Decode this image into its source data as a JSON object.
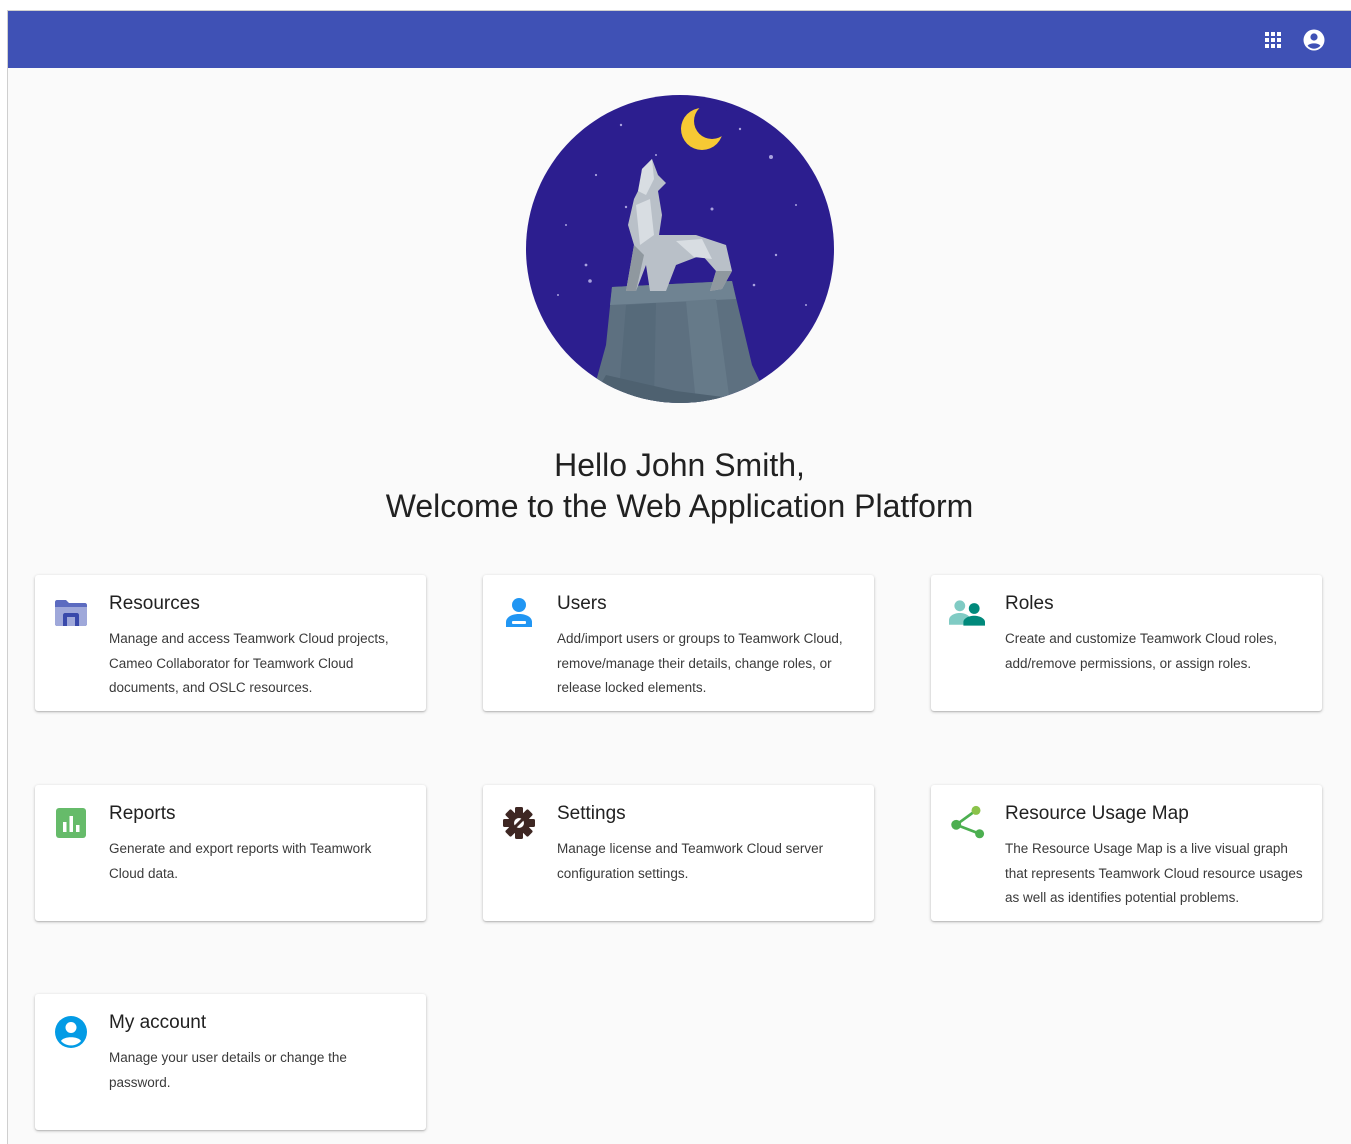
{
  "colors": {
    "topbar": "#3f51b5",
    "page_background": "#fafafa",
    "hero_sky": "#2c1e8f",
    "moon": "#f7c934"
  },
  "header": {
    "apps_icon": "grid-apps-icon",
    "account_icon": "account-circle-icon"
  },
  "greeting": {
    "line1": "Hello John Smith,",
    "line2": "Welcome to the Web Application Platform"
  },
  "cards": [
    {
      "title": "Resources",
      "icon": "folder-icon",
      "description": "Manage and access Teamwork Cloud projects, Cameo Collaborator for Teamwork Cloud documents, and OSLC resources."
    },
    {
      "title": "Users",
      "icon": "user-icon",
      "description": "Add/import users or groups to Teamwork Cloud, remove/manage their details, change roles, or release locked elements."
    },
    {
      "title": "Roles",
      "icon": "people-icon",
      "description": "Create and customize Teamwork Cloud roles, add/remove permissions, or assign roles."
    },
    {
      "title": "Reports",
      "icon": "bar-chart-icon",
      "description": "Generate and export reports with Teamwork Cloud data."
    },
    {
      "title": "Settings",
      "icon": "gear-icon",
      "description": "Manage license and Teamwork Cloud server configuration settings."
    },
    {
      "title": "Resource Usage Map",
      "icon": "share-graph-icon",
      "description": "The Resource Usage Map is a live visual graph that represents Teamwork Cloud resource usages as well as identifies potential problems."
    },
    {
      "title": "My account",
      "icon": "account-circle-icon",
      "description": "Manage your user details or change the password."
    }
  ]
}
